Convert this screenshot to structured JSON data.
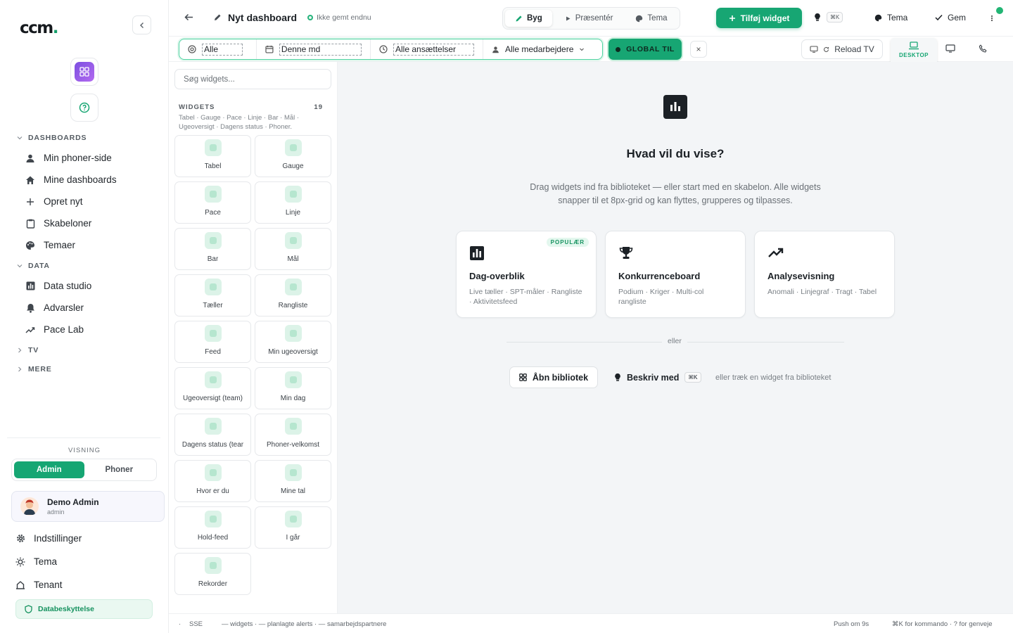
{
  "sidebar": {
    "logo": "ccm",
    "logo_dot": ".",
    "sections": {
      "dashboards": "DASHBOARDS",
      "data": "DATA",
      "tv": "TV",
      "mere": "MERE"
    },
    "dashboards": [
      "Min phoner-side",
      "Mine dashboards",
      "Opret nyt",
      "Skabeloner",
      "Temaer"
    ],
    "data_items": [
      "Data studio",
      "Advarsler",
      "Pace Lab"
    ],
    "visning_label": "VISNING",
    "visning_options": [
      "Admin",
      "Phoner"
    ],
    "user": {
      "name": "Demo Admin",
      "role": "admin"
    },
    "bottom": [
      "Indstillinger",
      "Tema",
      "Tenant"
    ],
    "data_protection": "Databeskyttelse"
  },
  "topbar": {
    "title": "Nyt dashboard",
    "save_status": "Ikke gemt endnu",
    "modes": [
      "Byg",
      "Præsentér",
      "Tema"
    ],
    "add_widget": "Tilføj widget",
    "shortcut": "⌘K",
    "theme": "Tema",
    "save": "Gem"
  },
  "filters": {
    "scope": "Alle",
    "period": "Denne md",
    "employment": "Alle ansættelser",
    "employees": "Alle medarbejdere",
    "global": "GLOBAL TIL",
    "close": "×",
    "reload_tv": "Reload TV",
    "device_desktop": "DESKTOP"
  },
  "library": {
    "search_placeholder": "Søg widgets...",
    "heading": "WIDGETS",
    "count": "19",
    "subtitle": "Tabel · Gauge · Pace · Linje · Bar · Mål · Ugeoversigt · Dagens status · Phoner.",
    "widgets": [
      "Tabel",
      "Gauge",
      "Pace",
      "Linje",
      "Bar",
      "Mål",
      "Tæller",
      "Rangliste",
      "Feed",
      "Min ugeoversigt",
      "Ugeoversigt (team)",
      "Min dag",
      "Dagens status (tear",
      "Phoner-velkomst",
      "Hvor er du",
      "Mine tal",
      "Hold-feed",
      "I går",
      "Rekorder"
    ]
  },
  "canvas": {
    "headline": "Hvad vil du vise?",
    "description": "Drag widgets ind fra biblioteket — eller start med en skabelon. Alle widgets snapper til et 8px-grid og kan flyttes, grupperes og tilpasses.",
    "templates": [
      {
        "title": "Dag-overblik",
        "sub": "Live tæller · SPT-måler · Rangliste · Aktivitetsfeed",
        "badge": "POPULÆR"
      },
      {
        "title": "Konkurrenceboard",
        "sub": "Podium · Kriger · Multi-col rangliste"
      },
      {
        "title": "Analysevisning",
        "sub": "Anomali · Linjegraf · Tragt · Tabel"
      }
    ],
    "or": "eller",
    "open_library": "Åbn bibliotek",
    "describe_with": "Beskriv med",
    "hint": "eller træk en widget fra biblioteket"
  },
  "statusbar": {
    "sse": "SSE",
    "counts": "— widgets · — planlagte alerts · — samarbejdspartnere",
    "push": "Push om 9s",
    "shortcuts": "⌘K for kommando · ? for genveje"
  },
  "colors": {
    "accent": "#17a673",
    "purple": "#8b5cf6"
  }
}
